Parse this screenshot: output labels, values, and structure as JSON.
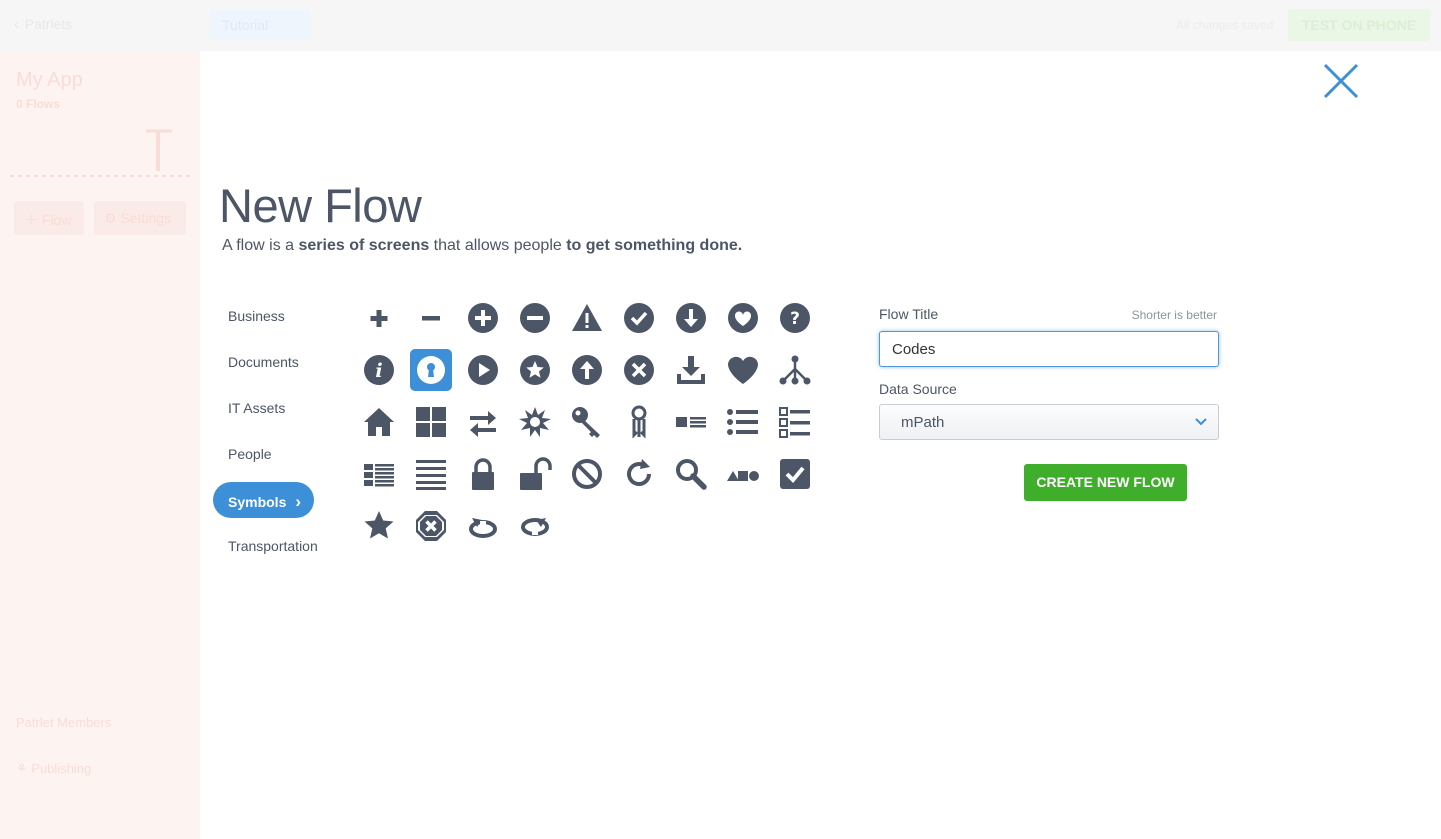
{
  "topbar": {
    "back_label": "Patrlets",
    "tutorial_label": "Tutorial",
    "saved_status": "All changes saved",
    "test_button": "TEST ON PHONE"
  },
  "sidebar": {
    "app_name": "My App",
    "flow_count": "0 Flows",
    "flow_button": "Flow",
    "settings_button": "Settings",
    "members_label": "Patrlet Members",
    "publishing_label": "Publishing"
  },
  "modal": {
    "title": "New Flow",
    "subtitle": {
      "part1": "A flow is a ",
      "bold1": "series of screens",
      "part2": " that allows people ",
      "bold2": "to get something done."
    },
    "categories": [
      "Business",
      "Documents",
      "IT Assets",
      "People",
      "Symbols",
      "Transportation"
    ],
    "active_category": "Symbols",
    "icons": [
      "plus-icon",
      "minus-icon",
      "plus-circle-icon",
      "minus-circle-icon",
      "warning-icon",
      "check-circle-icon",
      "arrow-down-circle-icon",
      "heart-circle-icon",
      "question-circle-icon",
      "info-circle-icon",
      "keyhole-icon",
      "play-circle-icon",
      "star-circle-icon",
      "arrow-up-circle-icon",
      "x-circle-icon",
      "download-icon",
      "heart-icon",
      "sitemap-icon",
      "home-icon",
      "grid-icon",
      "exchange-icon",
      "burst-icon",
      "key-icon",
      "keys-icon",
      "list-detail-icon",
      "list-bullets-icon",
      "checklist-icon",
      "table-list-icon",
      "align-justify-icon",
      "lock-icon",
      "unlock-icon",
      "ban-icon",
      "refresh-icon",
      "search-icon",
      "shapes-icon",
      "checkbox-icon",
      "star-icon",
      "octagon-x-icon",
      "undo-circular-icon",
      "redo-circular-icon"
    ],
    "selected_icon": "keyhole-icon",
    "form": {
      "title_label": "Flow Title",
      "title_hint": "Shorter is better",
      "title_value": "Codes",
      "source_label": "Data Source",
      "source_value": "mPath",
      "create_button": "CREATE NEW FLOW"
    }
  },
  "colors": {
    "accent": "#3d8fd8",
    "create": "#3fae2a",
    "icon": "#4c5666"
  }
}
